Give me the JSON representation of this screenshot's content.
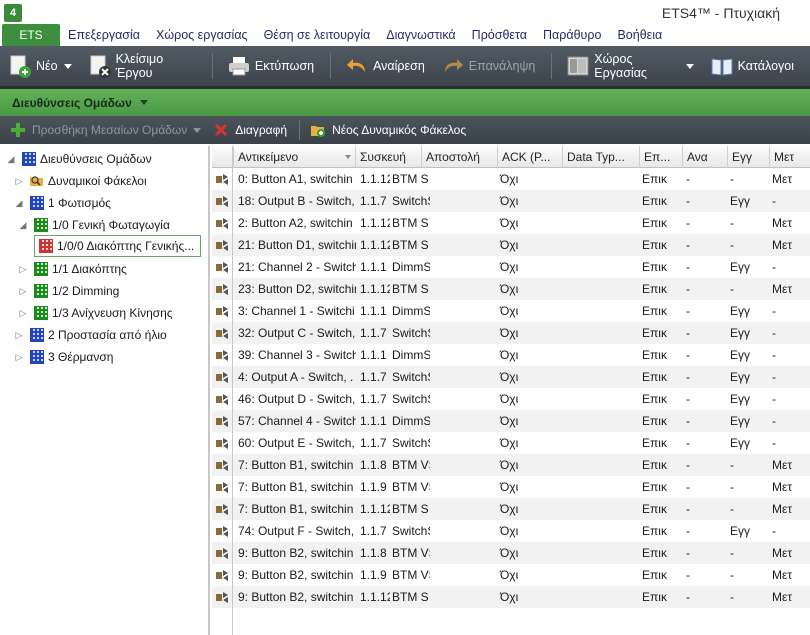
{
  "window": {
    "title": "ETS4™ - Πτυχιακή",
    "logo_text": "4"
  },
  "menubar": {
    "ets_label": "ETS",
    "items": [
      "Επεξεργασία",
      "Χώρος εργασίας",
      "Θέση σε λειτουργία",
      "Διαγνωστικά",
      "Πρόσθετα",
      "Παράθυρο",
      "Βοήθεια"
    ]
  },
  "toolbar": {
    "new_label": "Νέο",
    "close_project_label": "Κλείσιμο Έργου",
    "print_label": "Εκτύπωση",
    "undo_label": "Αναίρεση",
    "redo_label": "Επανάληψη",
    "workspace_label": "Χώρος Εργασίας",
    "catalogs_label": "Κατάλογοι"
  },
  "panel": {
    "title": "Διευθύνσεις Ομάδων"
  },
  "subtoolbar": {
    "add_middle_groups_label": "Προσθήκη Μεσαίων Ομάδων",
    "delete_label": "Διαγραφή",
    "new_dynamic_folder_label": "Νέος Δυναμικός Φάκελος"
  },
  "tree": {
    "items": [
      {
        "label": "Διευθύνσεις Ομάδων",
        "expander": "◢",
        "icon": "grid-blue-root-icon",
        "level": 0
      },
      {
        "label": "Δυναμικοί Φάκελοι",
        "expander": "▷",
        "icon": "folder-search-icon",
        "level": 1
      },
      {
        "label": "1 Φωτισμός",
        "expander": "◢",
        "icon": "grid-blue-icon",
        "level": 1
      },
      {
        "label": "1/0 Γενική Φωταγωγία",
        "expander": "◢",
        "icon": "grid-green-icon",
        "level": 2
      },
      {
        "label": "1/0/0 Διακόπτης Γενικής...",
        "expander": "",
        "icon": "grid-red-icon",
        "level": 3,
        "selected": true
      },
      {
        "label": "1/1 Διακόπτης",
        "expander": "▷",
        "icon": "grid-green-icon",
        "level": 2
      },
      {
        "label": "1/2 Dimming",
        "expander": "▷",
        "icon": "grid-green-icon",
        "level": 2
      },
      {
        "label": "1/3 Ανίχνευση Κίνησης",
        "expander": "▷",
        "icon": "grid-green-icon",
        "level": 2
      },
      {
        "label": "2 Προστασία από ήλιο",
        "expander": "▷",
        "icon": "grid-blue-icon",
        "level": 1
      },
      {
        "label": "3 Θέρμανση",
        "expander": "▷",
        "icon": "grid-blue-icon",
        "level": 1
      }
    ]
  },
  "grid": {
    "columns": [
      "Αντικείμενο",
      "Συσκευή",
      "Αποστολή",
      "ACK (P...",
      "Data Typ...",
      "Επ...",
      "Ανα",
      "Εγγ",
      "Μετ"
    ],
    "rows": [
      {
        "object": "0: Button A1, switchin",
        "device": "1.1.12",
        "device_name": "BTM S",
        "ack": "Όχι",
        "ep": "Επικ",
        "ana": "-",
        "egg": "-",
        "met": "Μετ"
      },
      {
        "object": "18: Output B - Switch,",
        "device": "1.1.7",
        "device_name": "SwitchS",
        "ack": "Όχι",
        "ep": "Επικ",
        "ana": "-",
        "egg": "Εγγ",
        "met": "-"
      },
      {
        "object": "2: Button A2, switchin",
        "device": "1.1.12",
        "device_name": "BTM S",
        "ack": "Όχι",
        "ep": "Επικ",
        "ana": "-",
        "egg": "-",
        "met": "Μετ"
      },
      {
        "object": "21: Button D1, switchin",
        "device": "1.1.12",
        "device_name": "BTM S",
        "ack": "Όχι",
        "ep": "Επικ",
        "ana": "-",
        "egg": "-",
        "met": "Μετ"
      },
      {
        "object": "21: Channel 2 - Switch",
        "device": "1.1.1",
        "device_name": "DimmS",
        "ack": "Όχι",
        "ep": "Επικ",
        "ana": "-",
        "egg": "Εγγ",
        "met": "-"
      },
      {
        "object": "23: Button D2, switchin",
        "device": "1.1.12",
        "device_name": "BTM S",
        "ack": "Όχι",
        "ep": "Επικ",
        "ana": "-",
        "egg": "-",
        "met": "Μετ"
      },
      {
        "object": "3: Channel 1 - Switchi",
        "device": "1.1.1",
        "device_name": "DimmS",
        "ack": "Όχι",
        "ep": "Επικ",
        "ana": "-",
        "egg": "Εγγ",
        "met": "-"
      },
      {
        "object": "32: Output C - Switch,",
        "device": "1.1.7",
        "device_name": "SwitchS",
        "ack": "Όχι",
        "ep": "Επικ",
        "ana": "-",
        "egg": "Εγγ",
        "met": "-"
      },
      {
        "object": "39: Channel 3 - Switch",
        "device": "1.1.1",
        "device_name": "DimmS",
        "ack": "Όχι",
        "ep": "Επικ",
        "ana": "-",
        "egg": "Εγγ",
        "met": "-"
      },
      {
        "object": "4: Output A - Switch, .",
        "device": "1.1.7",
        "device_name": "SwitchS",
        "ack": "Όχι",
        "ep": "Επικ",
        "ana": "-",
        "egg": "Εγγ",
        "met": "-"
      },
      {
        "object": "46: Output D - Switch,",
        "device": "1.1.7",
        "device_name": "SwitchS",
        "ack": "Όχι",
        "ep": "Επικ",
        "ana": "-",
        "egg": "Εγγ",
        "met": "-"
      },
      {
        "object": "57: Channel 4 - Switch",
        "device": "1.1.1",
        "device_name": "DimmS",
        "ack": "Όχι",
        "ep": "Επικ",
        "ana": "-",
        "egg": "Εγγ",
        "met": "-"
      },
      {
        "object": "60: Output E - Switch,",
        "device": "1.1.7",
        "device_name": "SwitchS",
        "ack": "Όχι",
        "ep": "Επικ",
        "ana": "-",
        "egg": "Εγγ",
        "met": "-"
      },
      {
        "object": "7: Button B1, switchin",
        "device": "1.1.8",
        "device_name": "BTM VS",
        "ack": "Όχι",
        "ep": "Επικ",
        "ana": "-",
        "egg": "-",
        "met": "Μετ"
      },
      {
        "object": "7: Button B1, switchin",
        "device": "1.1.9",
        "device_name": "BTM VS",
        "ack": "Όχι",
        "ep": "Επικ",
        "ana": "-",
        "egg": "-",
        "met": "Μετ"
      },
      {
        "object": "7: Button B1, switchin",
        "device": "1.1.12",
        "device_name": "BTM S",
        "ack": "Όχι",
        "ep": "Επικ",
        "ana": "-",
        "egg": "-",
        "met": "Μετ"
      },
      {
        "object": "74: Output F - Switch,",
        "device": "1.1.7",
        "device_name": "SwitchS",
        "ack": "Όχι",
        "ep": "Επικ",
        "ana": "-",
        "egg": "Εγγ",
        "met": "-"
      },
      {
        "object": "9: Button B2, switchin",
        "device": "1.1.8",
        "device_name": "BTM VS",
        "ack": "Όχι",
        "ep": "Επικ",
        "ana": "-",
        "egg": "-",
        "met": "Μετ"
      },
      {
        "object": "9: Button B2, switchin",
        "device": "1.1.9",
        "device_name": "BTM VS",
        "ack": "Όχι",
        "ep": "Επικ",
        "ana": "-",
        "egg": "-",
        "met": "Μετ"
      },
      {
        "object": "9: Button B2, switchin",
        "device": "1.1.12",
        "device_name": "BTM S",
        "ack": "Όχι",
        "ep": "Επικ",
        "ana": "-",
        "egg": "-",
        "met": "Μετ"
      }
    ]
  },
  "colors": {
    "accent_green": "#4a9a44",
    "toolbar_dark": "#3c434b",
    "menu_text": "#2a2a6a"
  }
}
